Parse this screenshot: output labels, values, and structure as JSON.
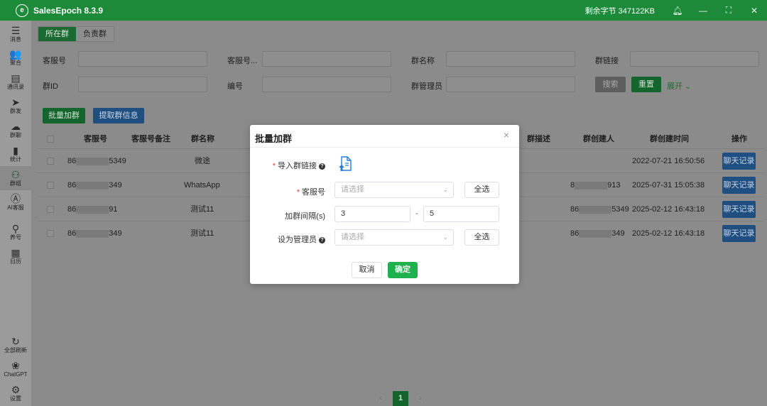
{
  "app": {
    "title": "SalesEpoch 8.3.9",
    "logo_letter": "e",
    "quota": "剩余字节 347122KB",
    "bell_icon": "bell-icon",
    "window_controls": [
      "—",
      "⛶",
      "✕"
    ]
  },
  "sidebar": {
    "items": [
      {
        "label": "消息",
        "icon": "chat-bubble-icon",
        "glyph": "☰"
      },
      {
        "label": "聚合",
        "icon": "users-aggregate-icon",
        "glyph": "👥"
      },
      {
        "label": "通讯录",
        "icon": "address-book-icon",
        "glyph": "▤"
      },
      {
        "label": "群发",
        "icon": "paper-plane-icon",
        "glyph": "➤"
      },
      {
        "label": "群聊",
        "icon": "group-chat-icon",
        "glyph": "☁"
      },
      {
        "label": "统计",
        "icon": "bar-chart-icon",
        "glyph": "▮"
      },
      {
        "label": "群组",
        "icon": "group-icon",
        "glyph": "⚇"
      },
      {
        "label": "AI客服",
        "icon": "ai-icon",
        "glyph": "Ⓐ"
      },
      {
        "label": "养号",
        "icon": "account-care-icon",
        "glyph": "⚲"
      },
      {
        "label": "日历",
        "icon": "calendar-icon",
        "glyph": "▦"
      }
    ],
    "bottom": [
      {
        "label": "全部刷新",
        "icon": "refresh-icon",
        "glyph": "↻"
      },
      {
        "label": "ChatGPT",
        "icon": "chatgpt-icon",
        "glyph": "❀"
      },
      {
        "label": "设置",
        "icon": "gear-icon",
        "glyph": "⚙"
      }
    ]
  },
  "tabs": [
    "所在群",
    "负责群"
  ],
  "filters": {
    "row1": [
      "客服号",
      "客服号...",
      "群名称",
      "群链接"
    ],
    "row2": [
      "群ID",
      "编号",
      "群管理员"
    ],
    "search": "搜索",
    "reset": "重置",
    "expand": "展开 ⌄"
  },
  "actions": {
    "batch_join": "批量加群",
    "extract_info": "提取群信息"
  },
  "table": {
    "headers": [
      "客服号",
      "客服号备注",
      "群名称",
      "群描述",
      "群创建人",
      "群创建时间",
      "操作"
    ],
    "rows": [
      {
        "phone_prefix": "86",
        "phone_suffix": "5349",
        "group": "微途",
        "creator_prefix": "",
        "creator_suffix": "",
        "created": "2022-07-21 16:50:56",
        "action": "聊天记录"
      },
      {
        "phone_prefix": "86",
        "phone_suffix": "349",
        "group": "WhatsApp",
        "creator_prefix": "8",
        "creator_suffix": "913",
        "created": "2025-07-31 15:05:38",
        "action": "聊天记录"
      },
      {
        "phone_prefix": "86",
        "phone_suffix": "91",
        "group": "测试11",
        "creator_prefix": "86",
        "creator_suffix": "5349",
        "created": "2025-02-12 16:43:18",
        "action": "聊天记录"
      },
      {
        "phone_prefix": "86",
        "phone_suffix": "349",
        "group": "测试11",
        "creator_prefix": "86",
        "creator_suffix": "349",
        "created": "2025-02-12 16:43:18",
        "action": "聊天记录"
      }
    ]
  },
  "pager": {
    "prev": "‹",
    "page": "1",
    "next": "›"
  },
  "modal": {
    "title": "批量加群",
    "close": "×",
    "import_link_label": "导入群链接",
    "agent_label": "客服号",
    "agent_placeholder": "请选择",
    "select_all": "全选",
    "interval_label": "加群间隔(s)",
    "interval_min": "3",
    "interval_sep": "-",
    "interval_max": "5",
    "admin_label": "设为管理员",
    "admin_placeholder": "请选择",
    "cancel": "取消",
    "confirm": "确定"
  }
}
